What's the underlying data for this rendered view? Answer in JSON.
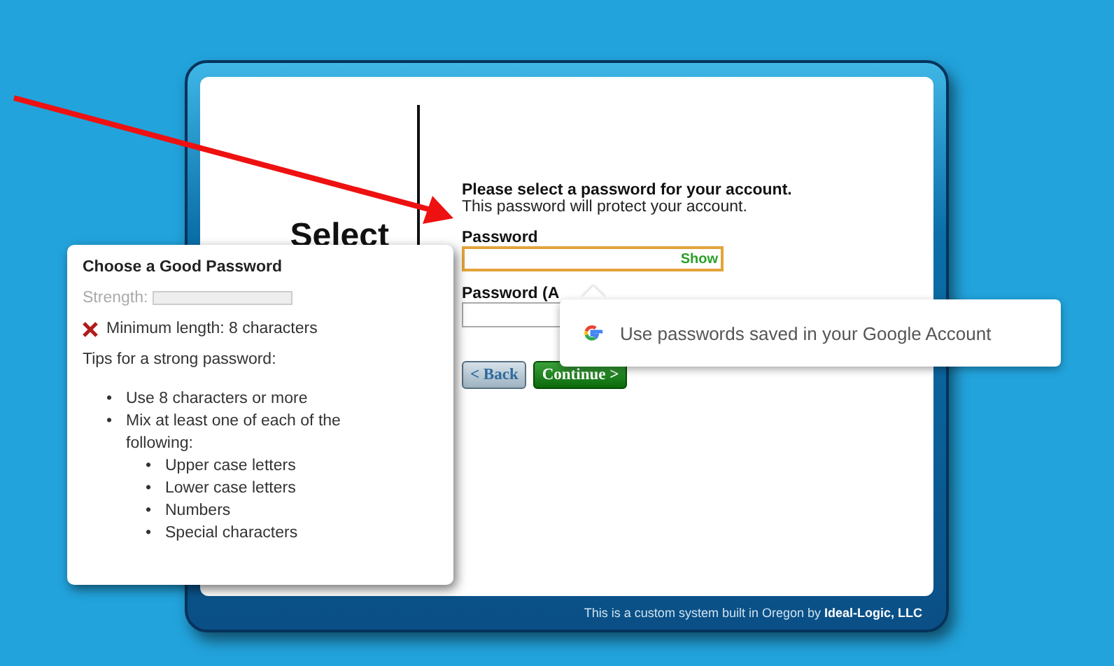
{
  "window": {
    "heading": "Select",
    "title": "Please select a password for your account.",
    "subtitle": "This password will protect your account.",
    "fields": [
      {
        "label": "Password",
        "show_label": "Show",
        "focused": true
      },
      {
        "label": "Password (A",
        "focused": false
      }
    ],
    "buttons": [
      {
        "label": "< Back",
        "kind": "back"
      },
      {
        "label": "Continue >",
        "kind": "primary"
      }
    ],
    "footer": "This is a custom system built in Oregon by **Ideal-Logic, LLC**"
  },
  "password_tips": {
    "title": "Choose a Good Password",
    "strength_label": "Strength:",
    "strength": {
      "level": 0
    },
    "requirements": [
      {
        "text": "Minimum length: 8 characters",
        "met": false
      }
    ],
    "tips_title": "Tips for a strong password:",
    "tips": [
      {
        "marker": "•",
        "text": "Use 8 characters or more"
      },
      {
        "marker": "•",
        "text": "Mix at least one of each of the following:",
        "children": [
          {
            "marker": "•",
            "text": "Upper case letters"
          },
          {
            "marker": "•",
            "text": "Lower case letters"
          },
          {
            "marker": "•",
            "text": "Numbers"
          },
          {
            "marker": "•",
            "text": "Special characters"
          }
        ]
      }
    ]
  },
  "autofill_popup": {
    "text": "Use passwords saved in your Google Account"
  }
}
